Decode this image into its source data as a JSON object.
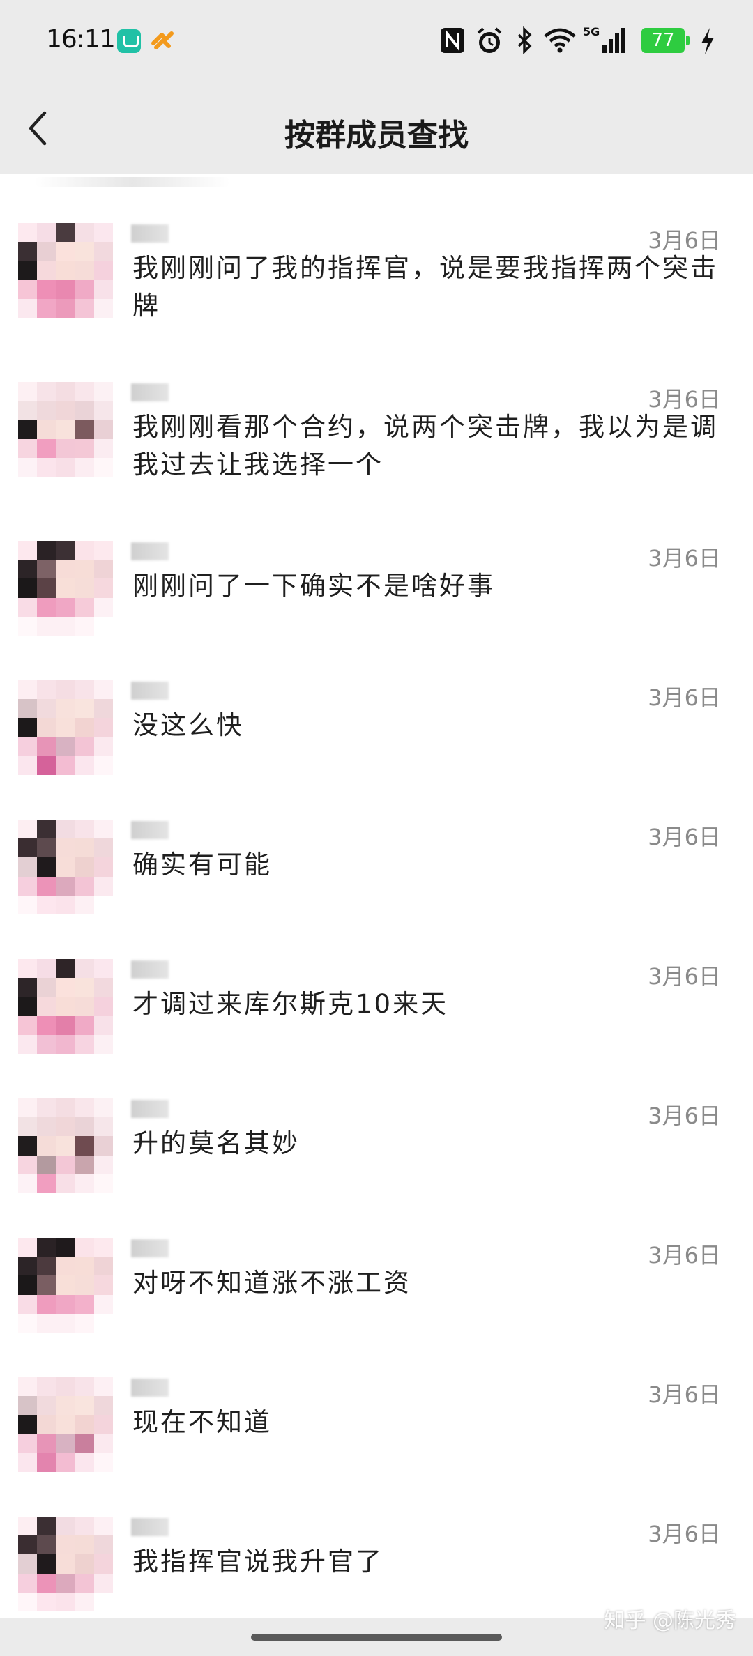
{
  "status_bar": {
    "time": "16:11",
    "battery": "77",
    "network": "5G",
    "icons": [
      "mi-home-icon",
      "pay-icon",
      "nfc-icon",
      "alarm-icon",
      "bluetooth-icon",
      "wifi-icon",
      "signal-icon",
      "battery-icon",
      "charging-icon"
    ]
  },
  "header": {
    "title": "按群成员查找",
    "back_icon": "chevron-left-icon"
  },
  "messages": [
    {
      "date": "3月6日",
      "text": "我刚刚问了我的指挥官，说是要我指挥两个突击牌"
    },
    {
      "date": "3月6日",
      "text": "我刚刚看那个合约，说两个突击牌，我以为是调我过去让我选择一个"
    },
    {
      "date": "3月6日",
      "text": "刚刚问了一下确实不是啥好事"
    },
    {
      "date": "3月6日",
      "text": "没这么快"
    },
    {
      "date": "3月6日",
      "text": "确实有可能"
    },
    {
      "date": "3月6日",
      "text": "才调过来库尔斯克10来天"
    },
    {
      "date": "3月6日",
      "text": "升的莫名其妙"
    },
    {
      "date": "3月6日",
      "text": "对呀不知道涨不涨工资"
    },
    {
      "date": "3月6日",
      "text": "现在不知道"
    },
    {
      "date": "3月6日",
      "text": "我指挥官说我升官了"
    }
  ],
  "watermark": "知乎 @陈光秀",
  "colors": {
    "bar_background": "#ebebeb",
    "date_text": "#8a8a8a",
    "battery": "#2ecc40"
  }
}
